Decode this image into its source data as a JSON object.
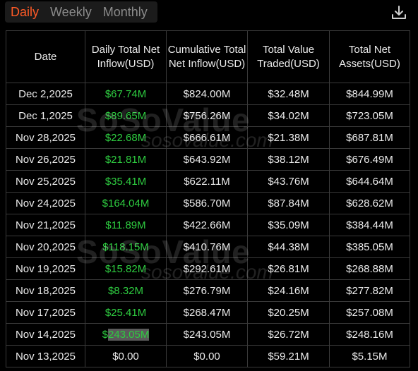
{
  "tabs": [
    {
      "label": "Daily",
      "active": true
    },
    {
      "label": "Weekly",
      "active": false
    },
    {
      "label": "Monthly",
      "active": false
    }
  ],
  "download_icon": "download-icon",
  "colors": {
    "accent": "#ff5a26",
    "positive": "#2ecc40",
    "background": "#000000",
    "border": "#3a3a3a"
  },
  "watermark": {
    "brand": "SoSoValue",
    "url": "sosovalue.com"
  },
  "table": {
    "headers": [
      "Date",
      "Daily Total Net Inflow(USD)",
      "Cumulative Total Net Inflow(USD)",
      "Total Value Traded(USD)",
      "Total Net Assets(USD)"
    ],
    "rows": [
      {
        "date": "Dec 2,2025",
        "inflow": "$67.74M",
        "cumulative": "$824.00M",
        "traded": "$32.48M",
        "assets": "$844.99M"
      },
      {
        "date": "Dec 1,2025",
        "inflow": "$89.65M",
        "cumulative": "$756.26M",
        "traded": "$34.02M",
        "assets": "$723.05M"
      },
      {
        "date": "Nov 28,2025",
        "inflow": "$22.68M",
        "cumulative": "$666.61M",
        "traded": "$21.38M",
        "assets": "$687.81M"
      },
      {
        "date": "Nov 26,2025",
        "inflow": "$21.81M",
        "cumulative": "$643.92M",
        "traded": "$38.12M",
        "assets": "$676.49M"
      },
      {
        "date": "Nov 25,2025",
        "inflow": "$35.41M",
        "cumulative": "$622.11M",
        "traded": "$43.76M",
        "assets": "$644.64M"
      },
      {
        "date": "Nov 24,2025",
        "inflow": "$164.04M",
        "cumulative": "$586.70M",
        "traded": "$87.84M",
        "assets": "$628.62M"
      },
      {
        "date": "Nov 21,2025",
        "inflow": "$11.89M",
        "cumulative": "$422.66M",
        "traded": "$35.09M",
        "assets": "$384.44M"
      },
      {
        "date": "Nov 20,2025",
        "inflow": "$118.15M",
        "cumulative": "$410.76M",
        "traded": "$44.38M",
        "assets": "$385.05M"
      },
      {
        "date": "Nov 19,2025",
        "inflow": "$15.82M",
        "cumulative": "$292.61M",
        "traded": "$26.81M",
        "assets": "$268.88M"
      },
      {
        "date": "Nov 18,2025",
        "inflow": "$8.32M",
        "cumulative": "$276.79M",
        "traded": "$24.16M",
        "assets": "$277.82M"
      },
      {
        "date": "Nov 17,2025",
        "inflow": "$25.41M",
        "cumulative": "$268.47M",
        "traded": "$20.25M",
        "assets": "$257.08M"
      },
      {
        "date": "Nov 14,2025",
        "inflow_prefix": "$",
        "inflow_highlight": "243.05M",
        "cumulative": "$243.05M",
        "traded": "$26.72M",
        "assets": "$248.16M"
      },
      {
        "date": "Nov 13,2025",
        "inflow": "$0.00",
        "cumulative": "$0.00",
        "traded": "$59.21M",
        "assets": "$5.15M"
      }
    ]
  }
}
